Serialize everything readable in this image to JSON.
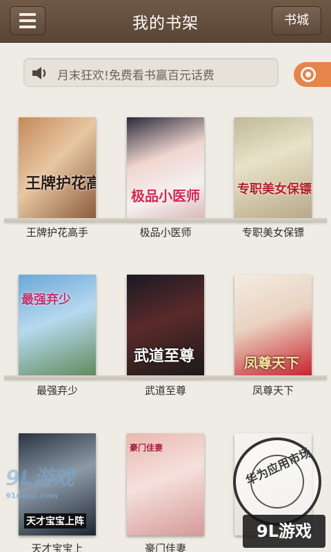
{
  "header": {
    "title": "我的书架",
    "store_label": "书城"
  },
  "notice": {
    "text": "月末狂欢!免费看书赢百元话费"
  },
  "books": [
    {
      "title": "王牌护花高手",
      "cover_text": "王牌护花高手"
    },
    {
      "title": "极品小医师",
      "cover_text": "极品小医师"
    },
    {
      "title": "专职美女保镖",
      "cover_text": "专职美女保镖"
    },
    {
      "title": "最强弃少",
      "cover_text": "最强弃少"
    },
    {
      "title": "武道至尊",
      "cover_text": "武道至尊"
    },
    {
      "title": "凤尊天下",
      "cover_text": "凤尊天下"
    },
    {
      "title": "天才宝宝上",
      "cover_text": "天才宝宝上阵"
    },
    {
      "title": "豪门佳妻",
      "cover_text": "豪门佳妻"
    }
  ],
  "watermarks": {
    "left": "9L游戏",
    "left_sub": "91danji.com",
    "right_badge": "9L游戏",
    "right_caption": "华为应用市场"
  },
  "colors": {
    "header_bg": "#5f4a3a",
    "page_bg": "#efece6",
    "search_accent": "#e6844a"
  }
}
